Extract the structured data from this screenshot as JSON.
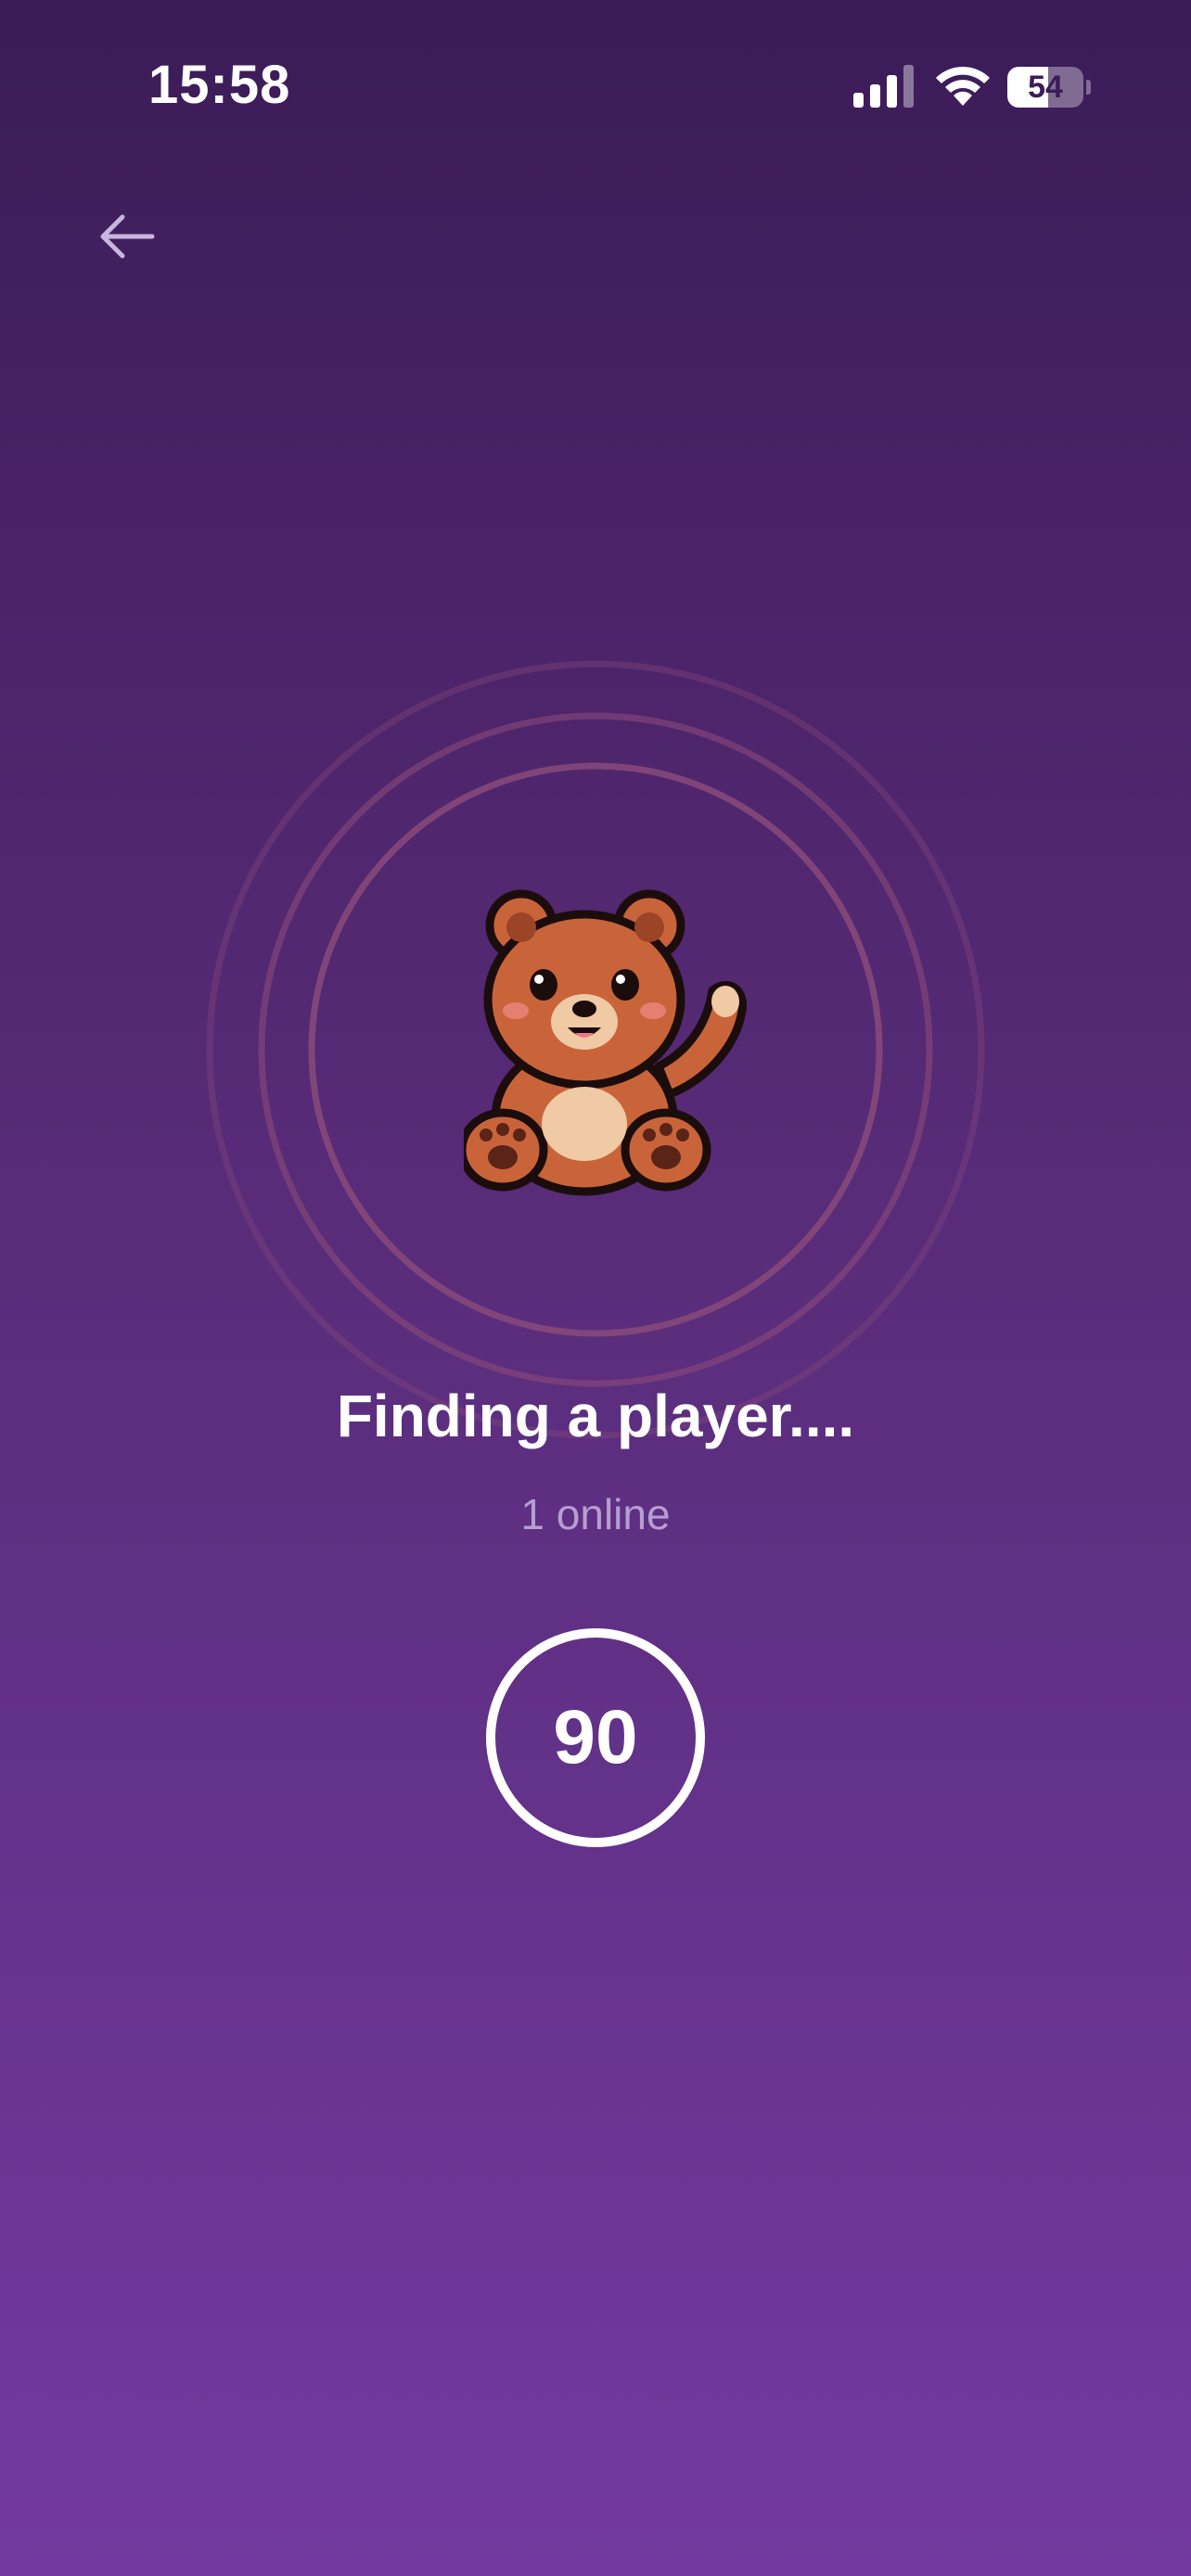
{
  "status_bar": {
    "time": "15:58",
    "battery_level": "54",
    "battery_fraction": 0.54,
    "icons": [
      "cellular-signal-icon",
      "wifi-icon",
      "battery-icon"
    ]
  },
  "navigation": {
    "back_icon": "arrow-left-icon"
  },
  "matchmaking": {
    "illustration": "waving-bear-icon",
    "title": "Finding a player....",
    "online_count": "1 online",
    "countdown": "90"
  },
  "colors": {
    "background_top": "#3b1c57",
    "background_bottom": "#7339a0",
    "ring": "#8a4a7a",
    "secondary_text": "#b69fd0",
    "bear_fur": "#c9643a",
    "bear_belly": "#f0c9a5"
  }
}
